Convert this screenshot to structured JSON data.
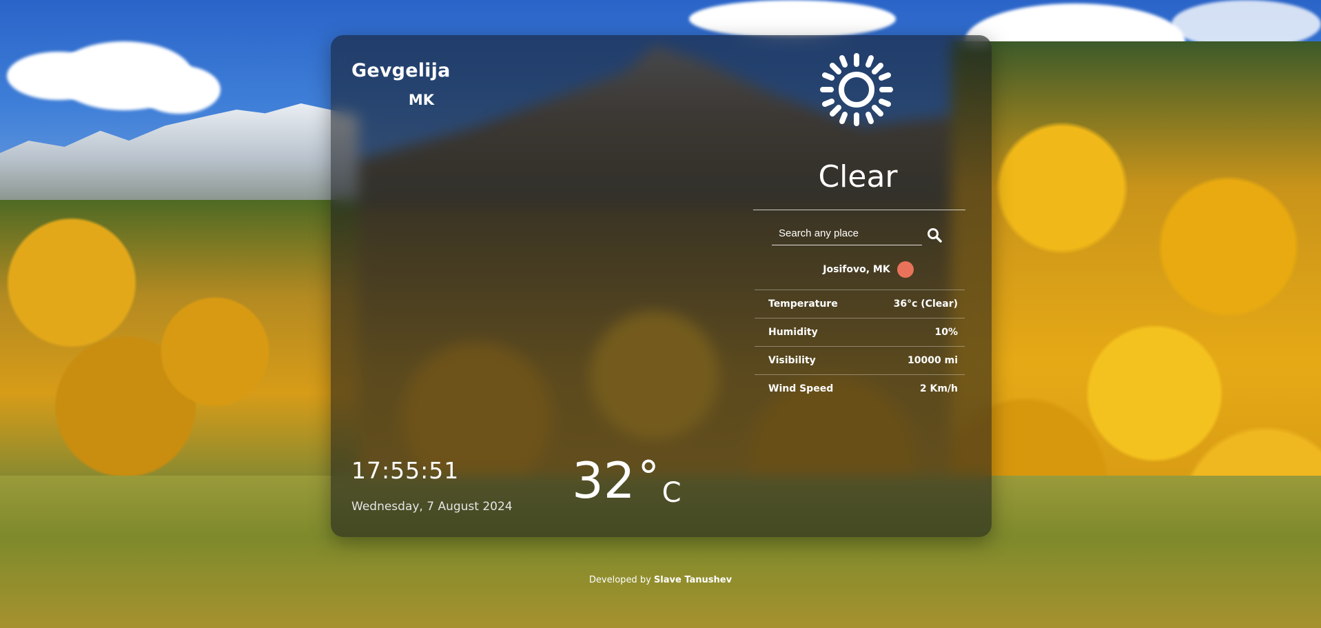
{
  "location": {
    "city": "Gevgelija",
    "country": "MK"
  },
  "clock": {
    "time": "17:55:51",
    "date": "Wednesday, 7 August 2024"
  },
  "current": {
    "temperature": "32",
    "degree_symbol": "°",
    "unit": "C",
    "condition": "Clear",
    "icon": "sun-icon"
  },
  "search": {
    "placeholder": "Search any place",
    "value": ""
  },
  "result": {
    "place": "Josifovo, MK",
    "status_color": "#e8735a"
  },
  "details": [
    {
      "label": "Temperature",
      "value": "36°c (Clear)"
    },
    {
      "label": "Humidity",
      "value": "10%"
    },
    {
      "label": "Visibility",
      "value": "10000 mi"
    },
    {
      "label": "Wind Speed",
      "value": "2 Km/h"
    }
  ],
  "footer": {
    "prefix": "Developed by",
    "author": "Slave Tanushev"
  }
}
